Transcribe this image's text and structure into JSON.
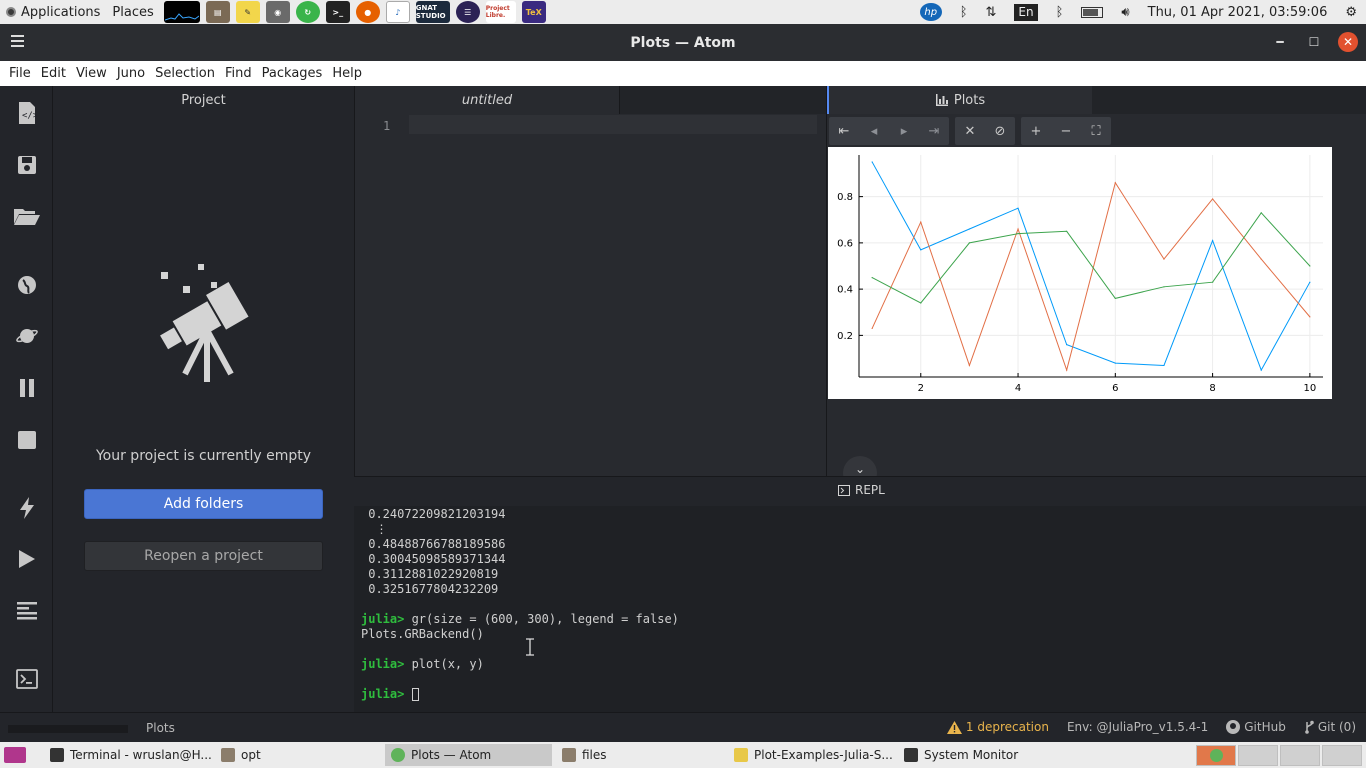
{
  "topbar": {
    "applications": "Applications",
    "places": "Places",
    "launchers": [
      "system-monitor-graph",
      "files",
      "text-editor",
      "screenshot",
      "refresh",
      "terminal",
      "firefox",
      "libreoffice-writer",
      "gnat-studio",
      "eclipse",
      "project-libre",
      "texmaker"
    ],
    "gnat_label": "GNAT STUDIO",
    "project_libre_label": "Project Libre.",
    "tex_label": "TeX",
    "keyboard_layout": "En",
    "datetime": "Thu, 01 Apr 2021, 03:59:06"
  },
  "window": {
    "title": "Plots — Atom"
  },
  "menubar": [
    "File",
    "Edit",
    "View",
    "Juno",
    "Selection",
    "Find",
    "Packages",
    "Help"
  ],
  "project": {
    "title": "Project",
    "empty_message": "Your project is currently empty",
    "add_folders": "Add folders",
    "reopen": "Reopen a project"
  },
  "editor": {
    "tab": "untitled",
    "line_number": "1"
  },
  "plots": {
    "tab": "Plots"
  },
  "chart_data": {
    "type": "line",
    "x": [
      1,
      2,
      3,
      4,
      5,
      6,
      7,
      8,
      9,
      10
    ],
    "series": [
      {
        "values": [
          0.95,
          0.57,
          0.66,
          0.75,
          0.16,
          0.08,
          0.07,
          0.61,
          0.05,
          0.43
        ],
        "color": "#009af9"
      },
      {
        "values": [
          0.23,
          0.69,
          0.07,
          0.66,
          0.05,
          0.86,
          0.53,
          0.79,
          0.53,
          0.28
        ],
        "color": "#e26f46"
      },
      {
        "values": [
          0.45,
          0.34,
          0.6,
          0.64,
          0.65,
          0.36,
          0.41,
          0.43,
          0.73,
          0.5
        ],
        "color": "#3da44d"
      }
    ],
    "xticks": [
      "2",
      "4",
      "6",
      "8",
      "10"
    ],
    "yticks": [
      "0.2",
      "0.4",
      "0.6",
      "0.8"
    ],
    "xlim": [
      0.73,
      10.27
    ],
    "ylim": [
      0.02,
      0.98
    ],
    "grid": true,
    "legend": false
  },
  "repl": {
    "tab": "REPL",
    "lines": [
      {
        "kind": "out",
        "text": " 0.24072209821203194"
      },
      {
        "kind": "out",
        "text": "  ⋮"
      },
      {
        "kind": "out",
        "text": " 0.48488766788189586"
      },
      {
        "kind": "out",
        "text": " 0.30045098589371344"
      },
      {
        "kind": "out",
        "text": " 0.3112881022920819"
      },
      {
        "kind": "out",
        "text": " 0.3251677804232209"
      },
      {
        "kind": "blank",
        "text": ""
      },
      {
        "kind": "cmd",
        "prompt": "julia>",
        "text": " gr(size = (600, 300), legend = false)"
      },
      {
        "kind": "out",
        "text": "Plots.GRBackend()"
      },
      {
        "kind": "blank",
        "text": ""
      },
      {
        "kind": "cmd",
        "prompt": "julia>",
        "text": " plot(x, y)"
      },
      {
        "kind": "blank",
        "text": ""
      },
      {
        "kind": "cmd",
        "prompt": "julia>",
        "text": " ",
        "cursor": true
      }
    ]
  },
  "statusbar": {
    "left_label": "Plots",
    "deprecation": "1 deprecation",
    "env": "Env: @JuliaPro_v1.5.4-1",
    "github": "GitHub",
    "git": "Git (0)"
  },
  "taskbar": [
    {
      "label": "Terminal - wruslan@H...",
      "icon_color": "#333"
    },
    {
      "label": "opt",
      "icon_color": "#8b7d6b"
    },
    {
      "label": "Plots — Atom",
      "icon_color": "#5fb35a",
      "active": true
    },
    {
      "label": "files",
      "icon_color": "#8b7d6b"
    },
    {
      "label": "Plot-Examples-Julia-S...",
      "icon_color": "#e8c848"
    },
    {
      "label": "System Monitor",
      "icon_color": "#333"
    }
  ]
}
